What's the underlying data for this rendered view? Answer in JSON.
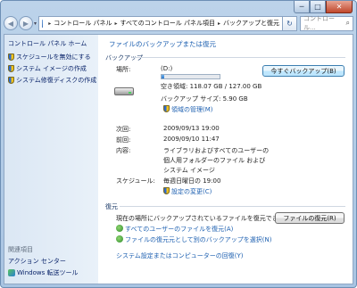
{
  "window": {
    "minimize": "─",
    "maximize": "□",
    "close": "✕"
  },
  "nav": {
    "back": "◀",
    "forward": "▶",
    "dropdown": "▾",
    "breadcrumbs": [
      "コントロール パネル",
      "すべてのコントロール パネル項目",
      "バックアップと復元"
    ],
    "separator": "▸",
    "refresh": "↻",
    "search_placeholder": "コントロール...",
    "search_icon": "⌕"
  },
  "sidebar": {
    "home": "コントロール パネル ホーム",
    "tasks": [
      {
        "label": "スケジュールを無効にする",
        "icon": "shield-icon"
      },
      {
        "label": "システム イメージの作成",
        "icon": "shield-icon"
      },
      {
        "label": "システム修復ディスクの作成",
        "icon": "shield-icon"
      }
    ],
    "related_header": "関連項目",
    "related": [
      {
        "label": "アクション センター",
        "icon": ""
      },
      {
        "label": "Windows 転送ツール",
        "icon": "transfer-icon"
      }
    ]
  },
  "main": {
    "header_link": "ファイルのバックアップまたは復元",
    "backup": {
      "section_title": "バックアップ",
      "location_label": "場所:",
      "drive": "(D:)",
      "usage_fraction": 0.0093,
      "free_space": "空き領域: 118.07 GB / 127.00 GB",
      "backup_size": "バックアップ サイズ: 5.90 GB",
      "manage_space": "領域の管理(M)",
      "backup_now": "今すぐバックアップ(B)",
      "next_label": "次回:",
      "next_value": "2009/09/13 19:00",
      "last_label": "前回:",
      "last_value": "2009/09/10 11:47",
      "contents_label": "内容:",
      "contents_lines": [
        "ライブラリおよびすべてのユーザーの",
        "個人用フォルダーのファイル および",
        "システム イメージ"
      ],
      "schedule_label": "スケジュール:",
      "schedule_value": "毎週日曜日の 19:00",
      "change_settings": "設定の変更(C)"
    },
    "restore": {
      "section_title": "復元",
      "description": "現在の場所にバックアップされているファイルを復元できます。",
      "restore_files_button": "ファイルの復元(R)",
      "restore_all_users": "すべてのユーザーのファイルを復元(A)",
      "select_another": "ファイルの復元元として別のバックアップを選択(N)",
      "recover_system": "システム設定またはコンピューターの回復(Y)"
    }
  }
}
